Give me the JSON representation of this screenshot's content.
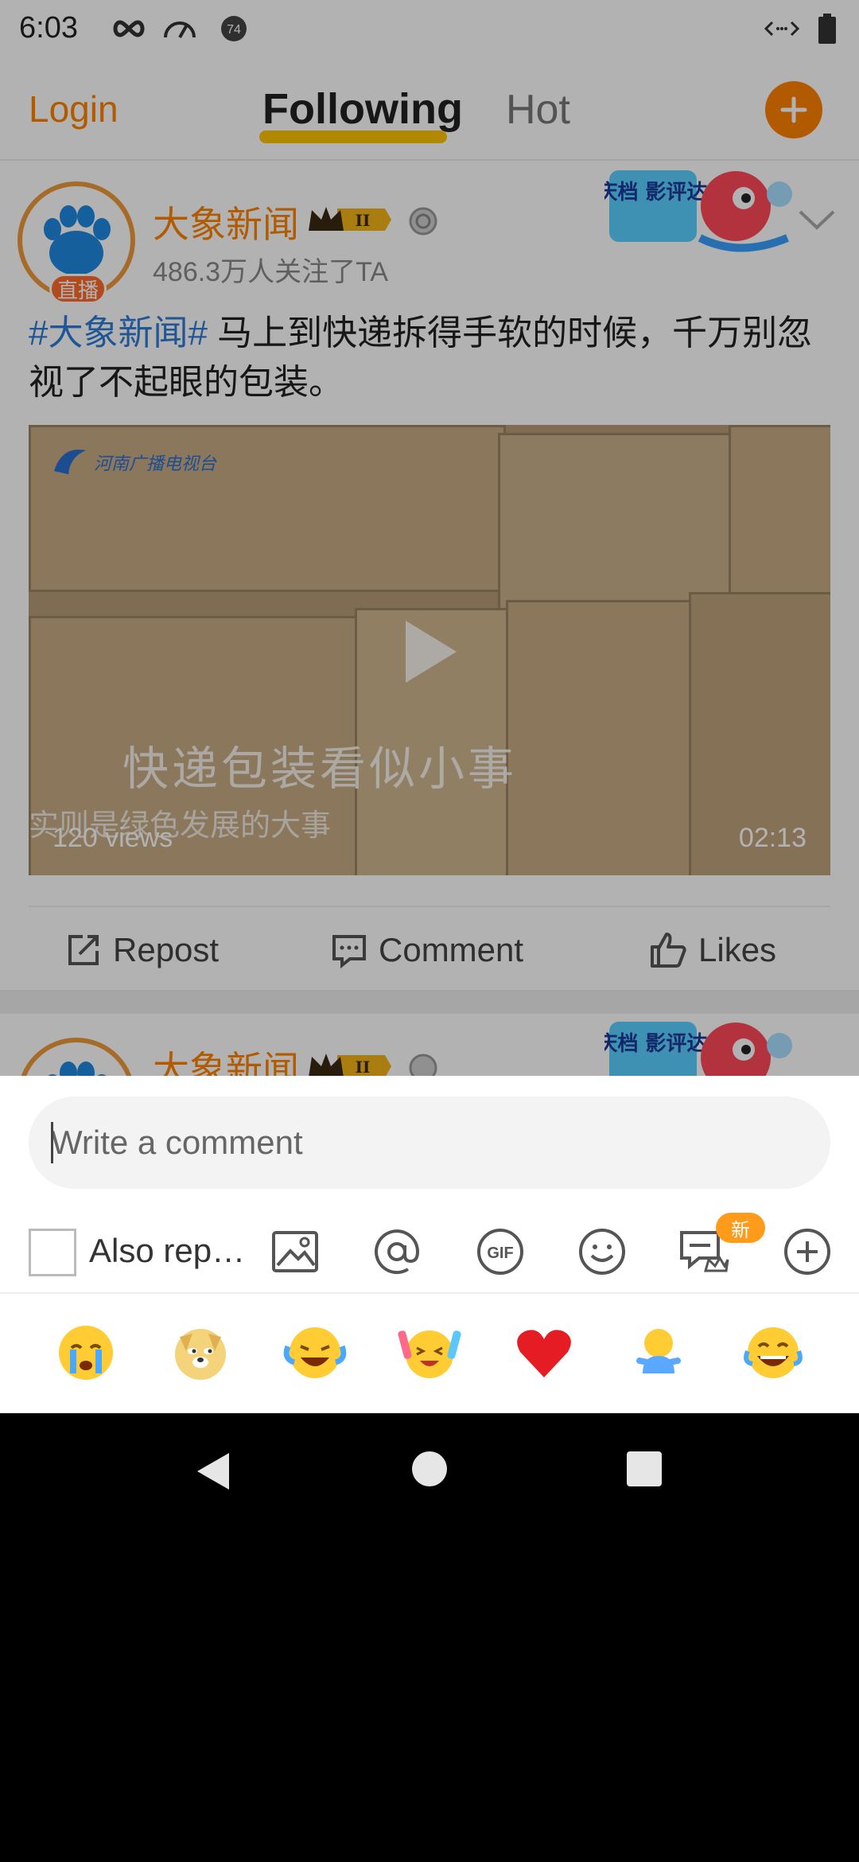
{
  "status_bar": {
    "time": "6:03",
    "notification_badge": "74"
  },
  "top_nav": {
    "login": "Login",
    "following": "Following",
    "hot": "Hot",
    "plus": "+"
  },
  "post": {
    "username": "大象新闻",
    "crown_level": "II",
    "followers": "486.3万人关注了TA",
    "live_label": "直播",
    "promo_badge_text": "国庆档 影评达人",
    "hashtag": "#大象新闻#",
    "text": " 马上到快递拆得手软的时候，千万别忽视了不起眼的包装。",
    "video": {
      "caption_main": "快递包装看似小事",
      "caption_sub": "实则是绿色发展的大事",
      "views": "120 views",
      "duration": "02:13",
      "logo_text": "河南广播电视台"
    },
    "actions": {
      "repost": "Repost",
      "comment": "Comment",
      "likes": "Likes"
    }
  },
  "post2": {
    "username": "大象新闻",
    "crown_level": "II"
  },
  "comment_sheet": {
    "input_placeholder": "Write a comment",
    "also_repost": "Also rep…",
    "new_badge": "新",
    "tools": [
      "image-icon",
      "at-icon",
      "gif-icon",
      "emoji-icon",
      "super-comment-icon",
      "add-icon"
    ],
    "emojis": [
      "crying-emoji",
      "doge-emoji",
      "laugh-cry-emoji",
      "cheering-emoji",
      "heart-emoji",
      "figure-emoji",
      "tears-of-joy-emoji"
    ]
  },
  "colors": {
    "accent": "#ff8200",
    "hashtag": "#2e7bd6"
  }
}
